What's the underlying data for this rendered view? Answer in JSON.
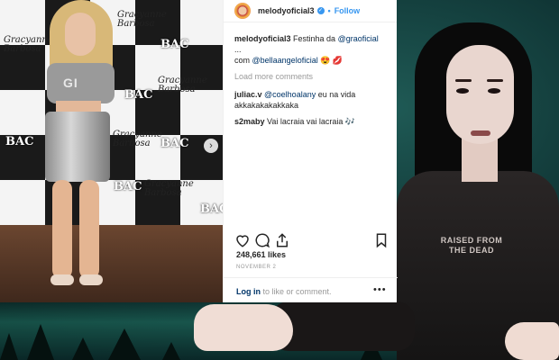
{
  "post": {
    "username": "melodyoficial3",
    "follow_label": "Follow",
    "caption_user": "melodyoficial3",
    "caption_text": " Festinha da ",
    "caption_mention1": "@graoficial",
    "caption_ellipsis": " ...",
    "caption_line2_prefix": "com ",
    "caption_mention2": "@bellaangeloficial",
    "caption_emoji": " 😍 💋",
    "load_more": "Load more comments",
    "comments": [
      {
        "user": "juliac.v",
        "mention": "@coelhoalany",
        "text": " eu na vida akkakakakakkaka"
      },
      {
        "user": "s2maby",
        "text": " Vai lacraia vai lacraia 🎶"
      }
    ],
    "likes": "248,661 likes",
    "date": "NOVEMBER 2",
    "login_link": "Log in",
    "login_text": " to like or comment.",
    "more_label": "•••"
  },
  "photo": {
    "shirt_text": "GI",
    "bac_labels": [
      "BAC",
      "BAC",
      "BAC",
      "BAC",
      "BAC",
      "BAC"
    ],
    "script_labels": [
      "Gracyanne Barbosa",
      "Gracyanne Barbosa",
      "Gracyanne Barbosa",
      "Gracyanne Barbosa",
      "Gracyanne Barbosa"
    ],
    "next_arrow": "›"
  },
  "presenter": {
    "shirt_text_line1": "RAISED FROM",
    "shirt_text_line2": "THE DEAD"
  },
  "icons": [
    "heart-icon",
    "comment-icon",
    "share-icon",
    "bookmark-icon",
    "verified-badge-icon"
  ],
  "colors": {
    "link": "#3897f0",
    "mention": "#003569",
    "muted": "#999999"
  }
}
